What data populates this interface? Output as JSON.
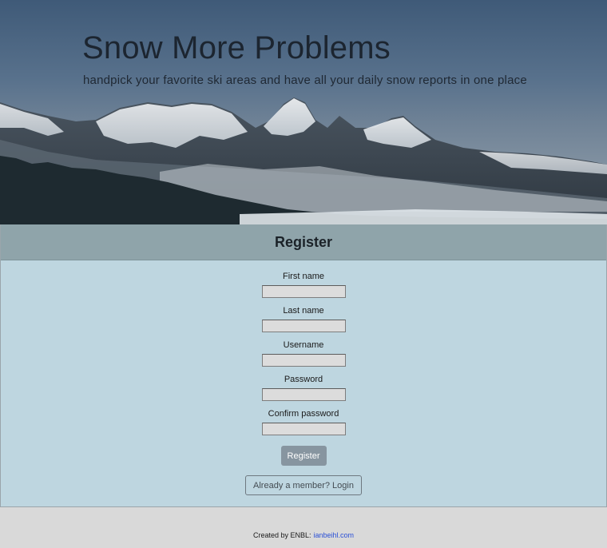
{
  "hero": {
    "title": "Snow More Problems",
    "subtitle": "handpick your favorite ski areas and have all your daily snow reports in one place"
  },
  "register": {
    "heading": "Register",
    "fields": [
      {
        "label": "First name",
        "value": ""
      },
      {
        "label": "Last name",
        "value": ""
      },
      {
        "label": "Username",
        "value": ""
      },
      {
        "label": "Password",
        "value": ""
      },
      {
        "label": "Confirm password",
        "value": ""
      }
    ],
    "submit_label": "Register",
    "login_label": "Already a member? Login"
  },
  "footer": {
    "credit_text": "Created by ENBL:",
    "link_text": "ianbeihl.com"
  },
  "colors": {
    "header_band": "#8fa4aa",
    "form_background": "#bed6e0",
    "submit_button": "#8795a0",
    "footer_background": "#d9d9d9",
    "link": "#2a4fd6"
  }
}
